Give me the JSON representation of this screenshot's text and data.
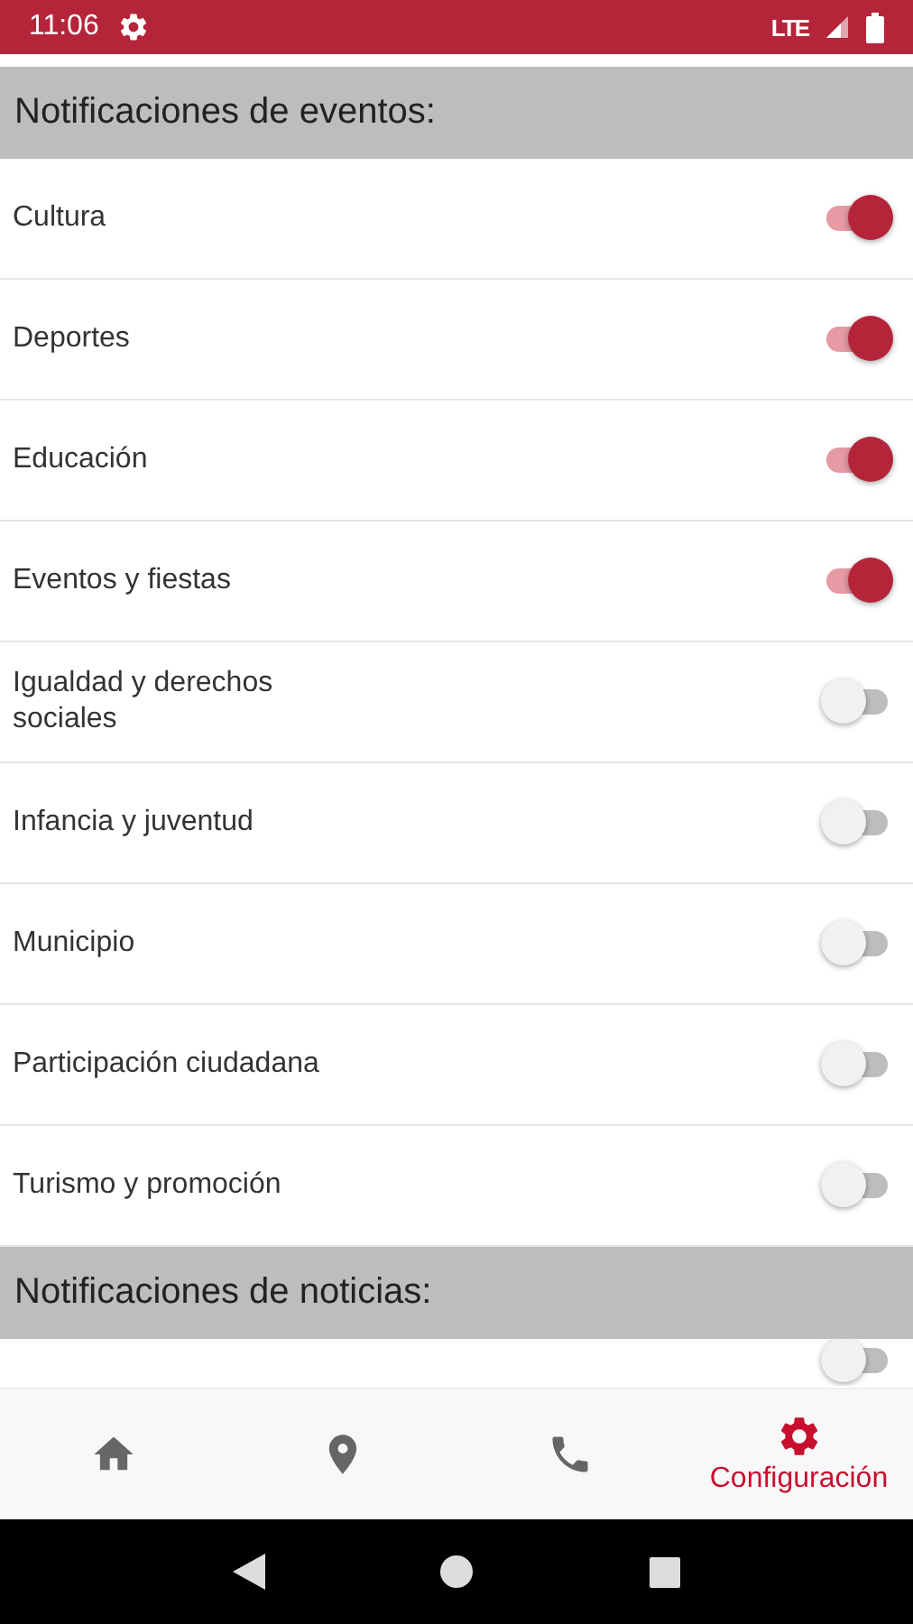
{
  "status_bar": {
    "time": "11:06",
    "network": "LTE"
  },
  "sections": [
    {
      "title": "Notificaciones de eventos:",
      "items": [
        {
          "label": "Cultura",
          "on": true
        },
        {
          "label": "Deportes",
          "on": true
        },
        {
          "label": "Educación",
          "on": true
        },
        {
          "label": "Eventos y fiestas",
          "on": true
        },
        {
          "label": "Igualdad y derechos sociales",
          "on": false
        },
        {
          "label": "Infancia y juventud",
          "on": false
        },
        {
          "label": "Municipio",
          "on": false
        },
        {
          "label": "Participación ciudadana",
          "on": false
        },
        {
          "label": "Turismo y promoción",
          "on": false
        }
      ]
    },
    {
      "title": "Notificaciones de noticias:",
      "items": [
        {
          "on": false
        }
      ]
    }
  ],
  "bottom_nav": [
    {
      "selected": false
    },
    {
      "selected": false
    },
    {
      "selected": false
    },
    {
      "label": "Configuración",
      "selected": true
    }
  ]
}
